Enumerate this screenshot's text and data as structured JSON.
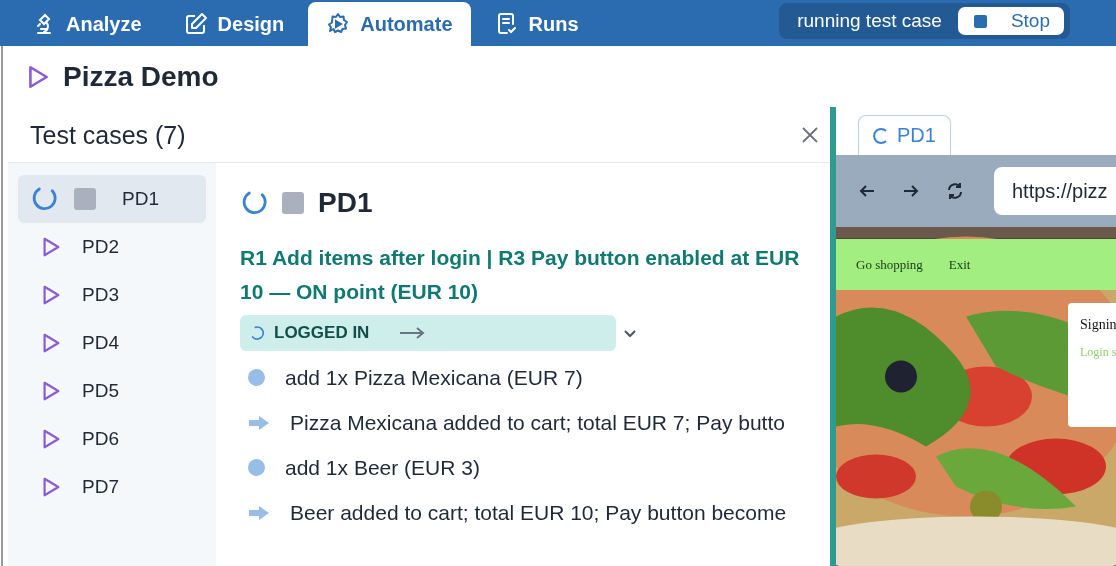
{
  "nav": {
    "tabs": [
      {
        "label": "Analyze",
        "selected": false
      },
      {
        "label": "Design",
        "selected": false
      },
      {
        "label": "Automate",
        "selected": true
      },
      {
        "label": "Runs",
        "selected": false
      }
    ],
    "status": {
      "text": "running test case",
      "button": "Stop"
    }
  },
  "project": {
    "title": "Pizza Demo"
  },
  "test_cases": {
    "title": "Test cases (7)",
    "items": [
      {
        "label": "PD1",
        "kind": "running",
        "selected": true
      },
      {
        "label": "PD2",
        "kind": "idle",
        "selected": false
      },
      {
        "label": "PD3",
        "kind": "idle",
        "selected": false
      },
      {
        "label": "PD4",
        "kind": "idle",
        "selected": false
      },
      {
        "label": "PD5",
        "kind": "idle",
        "selected": false
      },
      {
        "label": "PD6",
        "kind": "idle",
        "selected": false
      },
      {
        "label": "PD7",
        "kind": "idle",
        "selected": false
      }
    ]
  },
  "detail": {
    "title": "PD1",
    "kind": "running",
    "requirement": "R1 Add items after login | R3 Pay button enabled at EUR 10 — ON point (EUR 10)",
    "state": {
      "label": "LOGGED IN",
      "expanded": false
    },
    "steps": [
      {
        "kind": "action",
        "text": "add 1x Pizza Mexicana (EUR 7)"
      },
      {
        "kind": "expectation",
        "text": "Pizza Mexicana added to cart; total EUR 7; Pay butto"
      },
      {
        "kind": "action",
        "text": "add 1x Beer (EUR 3)"
      },
      {
        "kind": "expectation",
        "text": "Beer added to cart; total EUR 10; Pay button become"
      }
    ]
  },
  "browser": {
    "tab": "PD1",
    "url": "https://pizz",
    "page": {
      "nav": [
        "Go shopping",
        "Exit"
      ],
      "dialog": {
        "title": "Signin",
        "message": "Login s"
      }
    }
  }
}
